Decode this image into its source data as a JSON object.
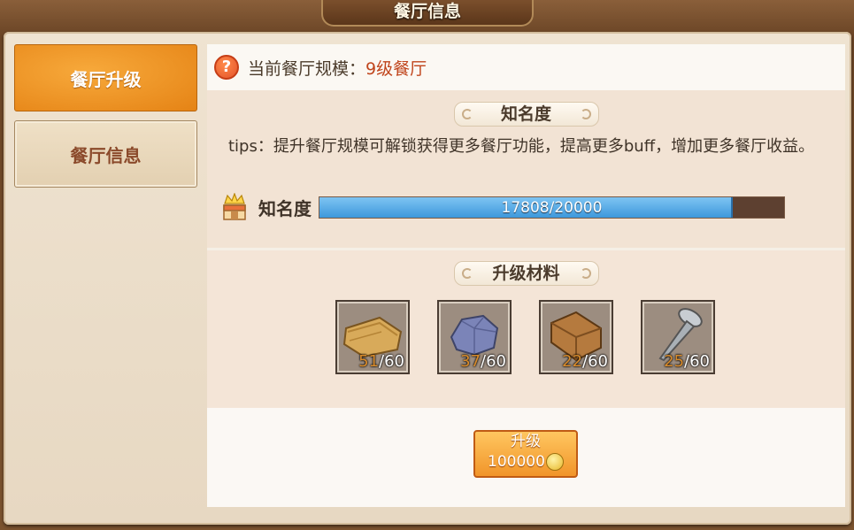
{
  "header": {
    "title": "餐厅信息"
  },
  "sidebar": {
    "items": [
      {
        "label": "餐厅升级",
        "active": true
      },
      {
        "label": "餐厅信息",
        "active": false
      }
    ]
  },
  "restaurant": {
    "scale_label": "当前餐厅规模：",
    "scale_value": "9级餐厅"
  },
  "fame": {
    "section_title": "知名度",
    "tips": "tips：提升餐厅规模可解锁获得更多餐厅功能，提高更多buff，增加更多餐厅收益。",
    "label": "知名度",
    "current": 17808,
    "max": 20000,
    "progress_text": "17808/20000"
  },
  "materials": {
    "section_title": "升级材料",
    "items": [
      {
        "icon": "wood-plank-icon",
        "have": "51",
        "need": "/60"
      },
      {
        "icon": "stone-ore-icon",
        "have": "37",
        "need": "/60"
      },
      {
        "icon": "brick-icon",
        "have": "22",
        "need": "/60"
      },
      {
        "icon": "nail-icon",
        "have": "25",
        "need": "/60"
      }
    ]
  },
  "upgrade": {
    "label": "升级",
    "cost": "100000",
    "currency_icon": "gold-coin-icon"
  },
  "colors": {
    "accent": "#f1952a",
    "bar_fill": "#3d98dc",
    "value_text": "#c0451c"
  }
}
